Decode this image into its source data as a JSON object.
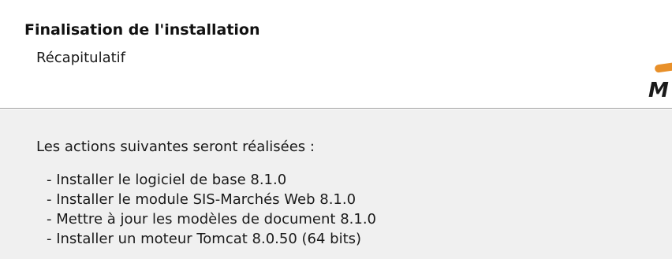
{
  "header": {
    "title": "Finalisation de l'installation",
    "subtitle": "Récapitulatif",
    "logo_letter": "M",
    "logo_accent_color": "#e8902a"
  },
  "body": {
    "intro": "Les actions suivantes seront réalisées :",
    "actions": [
      "- Installer le logiciel de base 8.1.0",
      "- Installer le module SIS-Marchés Web 8.1.0",
      "- Mettre à jour les modèles de document 8.1.0",
      "- Installer un moteur Tomcat 8.0.50 (64 bits)"
    ]
  }
}
